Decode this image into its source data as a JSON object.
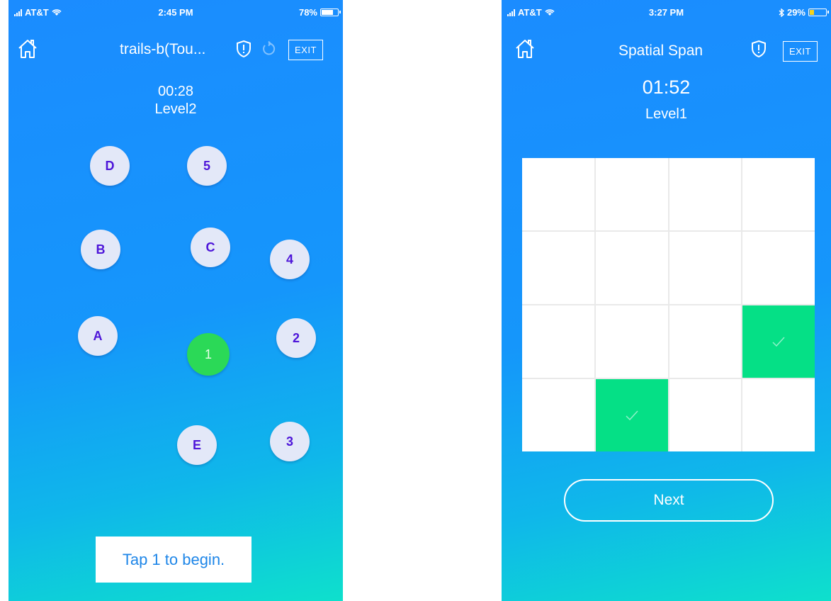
{
  "left_screen": {
    "status": {
      "carrier": "AT&T",
      "time": "2:45 PM",
      "battery_text": "78%",
      "battery_level": 0.78
    },
    "nav": {
      "title": "trails-b(Tou...",
      "exit_label": "EXIT",
      "home_icon": "home-icon",
      "shield_icon": "shield-alert-icon",
      "restart_icon": "restart-icon"
    },
    "timer": "00:28",
    "level": "Level2",
    "nodes": [
      {
        "label": "D"
      },
      {
        "label": "5"
      },
      {
        "label": "B"
      },
      {
        "label": "C"
      },
      {
        "label": "4"
      },
      {
        "label": "A"
      },
      {
        "label": "1",
        "active": true
      },
      {
        "label": "2"
      },
      {
        "label": "E"
      },
      {
        "label": "3"
      }
    ],
    "hint": "Tap 1 to begin.",
    "colors": {
      "active_node": "#2bd957",
      "node_text": "#4d15d9",
      "node_fill": "#e3e8f8"
    }
  },
  "right_screen": {
    "status": {
      "carrier": "AT&T",
      "time": "3:27 PM",
      "battery_text": "29%",
      "battery_level": 0.29,
      "bluetooth_icon": "bluetooth-icon"
    },
    "nav": {
      "title": "Spatial Span",
      "exit_label": "EXIT",
      "home_icon": "home-icon",
      "shield_icon": "shield-alert-icon"
    },
    "timer": "01:52",
    "level": "Level1",
    "grid": {
      "rows": 4,
      "cols": 4,
      "lit_cells": [
        [
          2,
          3
        ],
        [
          3,
          1
        ]
      ],
      "lit_color": "#05e086",
      "check_icon": "checkmark-icon"
    },
    "next_label": "Next"
  }
}
